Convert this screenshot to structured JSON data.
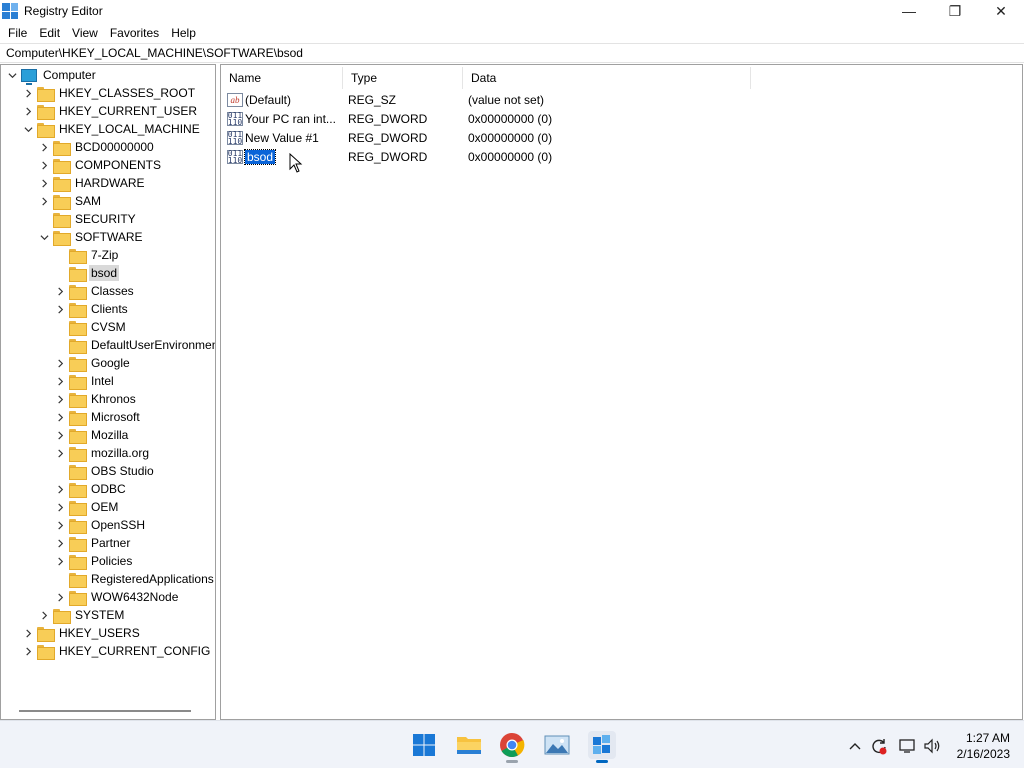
{
  "window": {
    "title": "Registry Editor",
    "minimize": "—",
    "maximize": "❐",
    "close": "✕"
  },
  "menu": [
    "File",
    "Edit",
    "View",
    "Favorites",
    "Help"
  ],
  "address": "Computer\\HKEY_LOCAL_MACHINE\\SOFTWARE\\bsod",
  "tree": [
    {
      "label": "Computer",
      "level": 0,
      "expander": "open",
      "icon": "computer-icon"
    },
    {
      "label": "HKEY_CLASSES_ROOT",
      "level": 1,
      "expander": "closed"
    },
    {
      "label": "HKEY_CURRENT_USER",
      "level": 1,
      "expander": "closed"
    },
    {
      "label": "HKEY_LOCAL_MACHINE",
      "level": 1,
      "expander": "open"
    },
    {
      "label": "BCD00000000",
      "level": 2,
      "expander": "closed"
    },
    {
      "label": "COMPONENTS",
      "level": 2,
      "expander": "closed"
    },
    {
      "label": "HARDWARE",
      "level": 2,
      "expander": "closed"
    },
    {
      "label": "SAM",
      "level": 2,
      "expander": "closed"
    },
    {
      "label": "SECURITY",
      "level": 2,
      "expander": "none"
    },
    {
      "label": "SOFTWARE",
      "level": 2,
      "expander": "open"
    },
    {
      "label": "7-Zip",
      "level": 3,
      "expander": "none"
    },
    {
      "label": "bsod",
      "level": 3,
      "expander": "none",
      "selected": true
    },
    {
      "label": "Classes",
      "level": 3,
      "expander": "closed"
    },
    {
      "label": "Clients",
      "level": 3,
      "expander": "closed"
    },
    {
      "label": "CVSM",
      "level": 3,
      "expander": "none"
    },
    {
      "label": "DefaultUserEnvironment",
      "level": 3,
      "expander": "none"
    },
    {
      "label": "Google",
      "level": 3,
      "expander": "closed"
    },
    {
      "label": "Intel",
      "level": 3,
      "expander": "closed"
    },
    {
      "label": "Khronos",
      "level": 3,
      "expander": "closed"
    },
    {
      "label": "Microsoft",
      "level": 3,
      "expander": "closed"
    },
    {
      "label": "Mozilla",
      "level": 3,
      "expander": "closed"
    },
    {
      "label": "mozilla.org",
      "level": 3,
      "expander": "closed"
    },
    {
      "label": "OBS Studio",
      "level": 3,
      "expander": "none"
    },
    {
      "label": "ODBC",
      "level": 3,
      "expander": "closed"
    },
    {
      "label": "OEM",
      "level": 3,
      "expander": "closed"
    },
    {
      "label": "OpenSSH",
      "level": 3,
      "expander": "closed"
    },
    {
      "label": "Partner",
      "level": 3,
      "expander": "closed"
    },
    {
      "label": "Policies",
      "level": 3,
      "expander": "closed"
    },
    {
      "label": "RegisteredApplications",
      "level": 3,
      "expander": "none"
    },
    {
      "label": "WOW6432Node",
      "level": 3,
      "expander": "closed"
    },
    {
      "label": "SYSTEM",
      "level": 2,
      "expander": "closed"
    },
    {
      "label": "HKEY_USERS",
      "level": 1,
      "expander": "closed"
    },
    {
      "label": "HKEY_CURRENT_CONFIG",
      "level": 1,
      "expander": "closed"
    }
  ],
  "columns": [
    "Name",
    "Type",
    "Data"
  ],
  "values": [
    {
      "name": "(Default)",
      "type": "REG_SZ",
      "data": "(value not set)",
      "icon": "string-value-icon",
      "icon_text": "ab"
    },
    {
      "name": "Your PC ran  int...",
      "type": "REG_DWORD",
      "data": "0x00000000 (0)",
      "icon": "dword-value-icon",
      "icon_text": "011\n110"
    },
    {
      "name": "New Value #1",
      "type": "REG_DWORD",
      "data": "0x00000000 (0)",
      "icon": "dword-value-icon",
      "icon_text": "011\n110"
    },
    {
      "name": "bsod",
      "type": "REG_DWORD",
      "data": "0x00000000 (0)",
      "icon": "dword-value-icon",
      "icon_text": "011\n110",
      "selected": true
    }
  ],
  "taskbar": {
    "apps": [
      "windows-start-icon",
      "file-explorer-icon",
      "chrome-icon",
      "photos-icon",
      "registry-editor-icon"
    ],
    "tray": {
      "chevron": "^",
      "sync": "⟳",
      "network": "▭",
      "volume": "🔊"
    },
    "clock": {
      "time": "1:27 AM",
      "date": "2/16/2023"
    }
  },
  "colors": {
    "selection": "#0a64d8",
    "folder": "#f8cd57",
    "taskbar": "#f0f3f9",
    "accent": "#0067c0"
  }
}
